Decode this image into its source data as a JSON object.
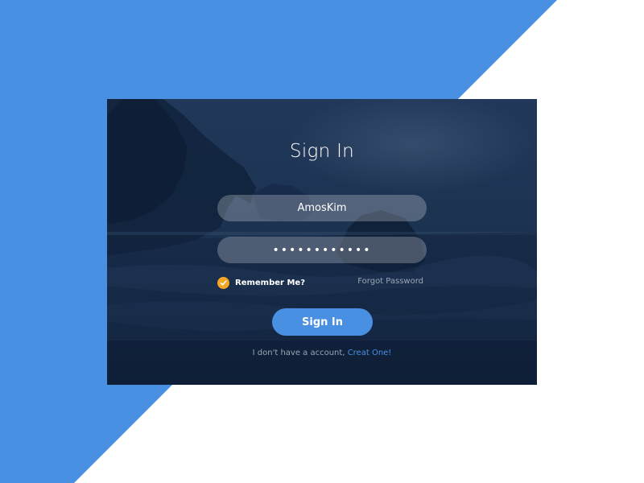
{
  "login": {
    "title": "Sign In",
    "username_value": "AmosKim",
    "password_value": "••••••••••••",
    "remember_label": "Remember Me?",
    "remember_checked": true,
    "forgot_label": "Forgot Password",
    "submit_label": "Sign In",
    "signup_prompt": "I don't have a account,",
    "signup_link": "Creat One!"
  },
  "colors": {
    "background_accent": "#4a90e2",
    "button": "#4a90e2",
    "checkbox": "#f5a623",
    "link": "#4a90e2",
    "muted_text": "#9aa6b6"
  },
  "icons": {
    "checkbox": "checkmark-icon"
  }
}
